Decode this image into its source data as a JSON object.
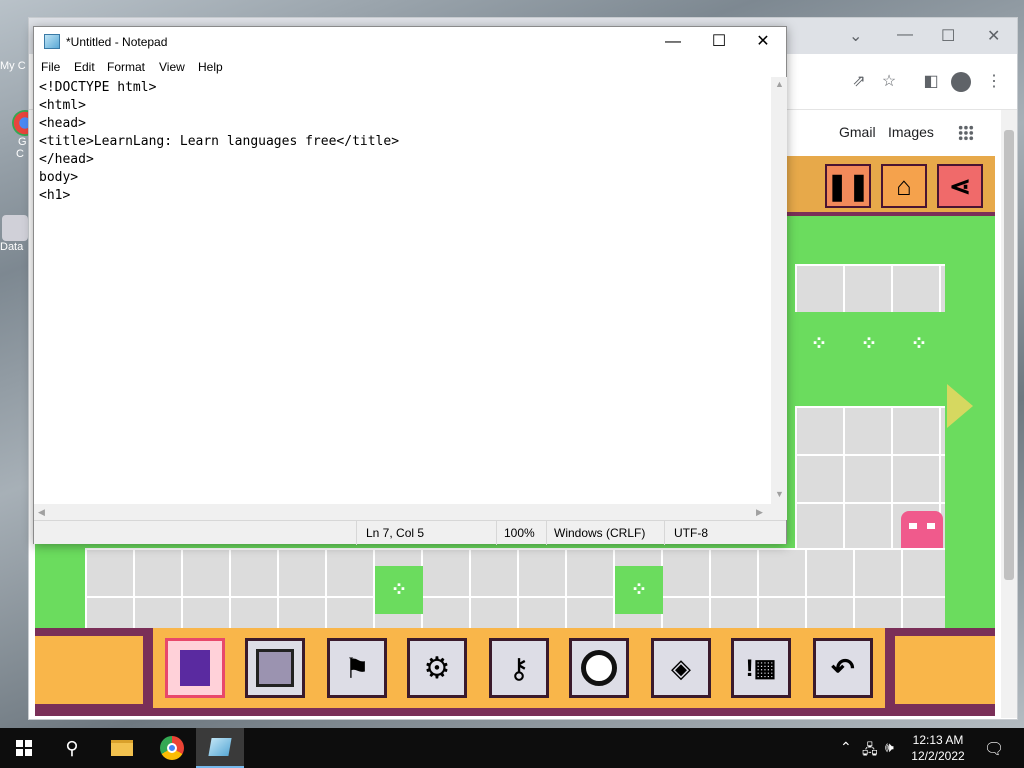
{
  "desktop": {
    "icons": [
      {
        "label": "My C"
      },
      {
        "label": "G"
      },
      {
        "label": "C"
      },
      {
        "label": "Data"
      }
    ]
  },
  "chrome": {
    "links": [
      "Gmail",
      "Images"
    ],
    "window_controls": [
      "⌄",
      "—",
      "☐",
      "✕"
    ]
  },
  "game": {
    "top_buttons": [
      "pause-icon",
      "home-icon",
      "share-icon"
    ],
    "tools": [
      "player-tool",
      "wall-tool",
      "flag-tool",
      "gear-tool",
      "key-tool",
      "ring-tool",
      "eraser-tool",
      "info-tool",
      "undo-tool"
    ],
    "colors": {
      "grass": "#6bdc5e",
      "frame": "#7a2f58",
      "panel": "#f9b64a",
      "enemy": "#f05a8c"
    }
  },
  "notepad": {
    "title": "*Untitled - Notepad",
    "menu": [
      "File",
      "Edit",
      "Format",
      "View",
      "Help"
    ],
    "content": "<!DOCTYPE html>\n<html>\n<head>\n<title>LearnLang: Learn languages free</title>\n</head>\nbody>\n<h1>",
    "status": {
      "position": "Ln 7, Col 5",
      "zoom": "100%",
      "line_ending": "Windows (CRLF)",
      "encoding": "UTF-8"
    }
  },
  "taskbar": {
    "apps": [
      "start-icon",
      "search-icon",
      "file-explorer-icon",
      "chrome-icon",
      "notepad-icon"
    ],
    "time": "12:13 AM",
    "date": "12/2/2022"
  }
}
